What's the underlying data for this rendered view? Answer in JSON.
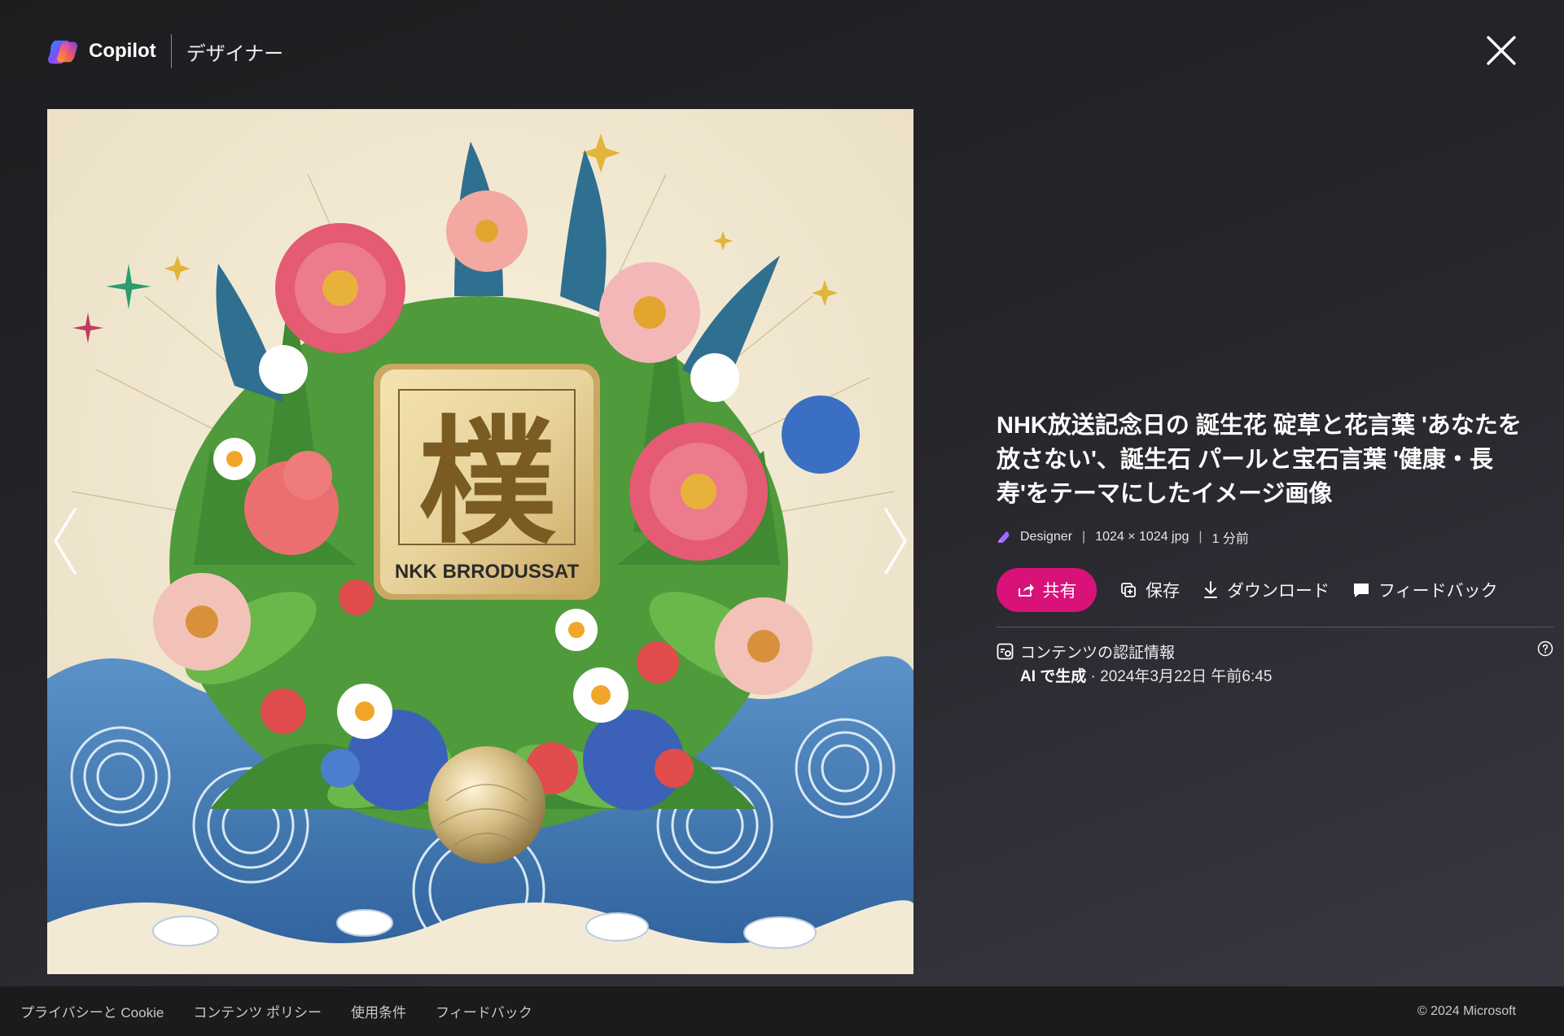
{
  "header": {
    "brand": "Copilot",
    "product": "デザイナー"
  },
  "image": {
    "sign_char": "樸",
    "sign_text": "NKK BRRODUSSAT"
  },
  "detail": {
    "title": "NHK放送記念日の 誕生花 碇草と花言葉 'あなたを放さない'、誕生石 パールと宝石言葉 '健康・長寿'をテーマにしたイメージ画像",
    "meta": {
      "source": "Designer",
      "dimensions": "1024 × 1024 jpg",
      "time": "1 分前"
    },
    "actions": {
      "share": "共有",
      "save": "保存",
      "download": "ダウンロード",
      "feedback": "フィードバック"
    },
    "credentials": {
      "heading": "コンテンツの認証情報",
      "generated": "AI で生成",
      "date": " · 2024年3月22日 午前6:45"
    }
  },
  "footer": {
    "links": [
      "プライバシーと Cookie",
      "コンテンツ ポリシー",
      "使用条件",
      "フィードバック"
    ],
    "copyright": "© 2024 Microsoft"
  },
  "colors": {
    "accent": "#d9127a",
    "background": "#25252a",
    "footer": "#1b1b1d"
  }
}
